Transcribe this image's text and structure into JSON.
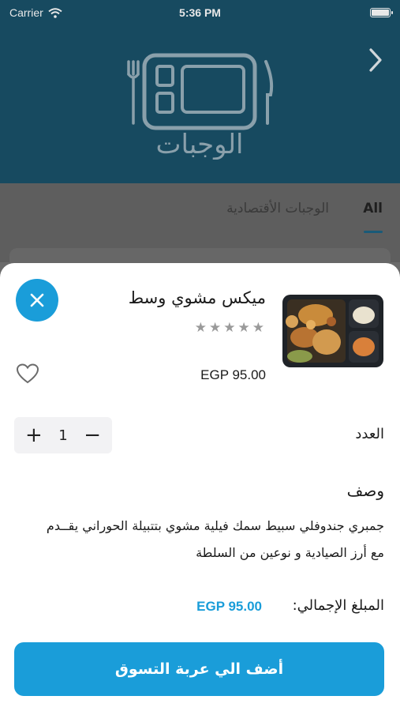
{
  "status_bar": {
    "carrier": "Carrier",
    "time": "5:36 PM"
  },
  "header": {
    "logo_text": "الوجبات",
    "back_icon": "chevron-right-icon"
  },
  "tabs": [
    {
      "label": "All",
      "active": true
    },
    {
      "label": "الوجبات الأقتصادية",
      "active": false
    }
  ],
  "item": {
    "title": "ميكس مشوي وسط",
    "rating_stars": 0,
    "rating_max": 5,
    "price": "EGP 95.00",
    "favorite": false
  },
  "quantity": {
    "label": "العدد",
    "value": "1",
    "plus": "+",
    "minus": "−"
  },
  "description": {
    "title": "وصف",
    "text": "جمبري جندوفلي سبيط سمك فيلية مشوي بتتبيلة الحوراني يقــدم مع أرز الصيادية و نوعين من السلطة"
  },
  "total": {
    "label": "المبلغ الإجمالي:",
    "value": "EGP 95.00"
  },
  "actions": {
    "add_to_cart": "أضف الي عربة التسوق"
  },
  "colors": {
    "accent": "#1a9dd9",
    "header_bg": "#174a60",
    "star": "#9a9a9a"
  }
}
